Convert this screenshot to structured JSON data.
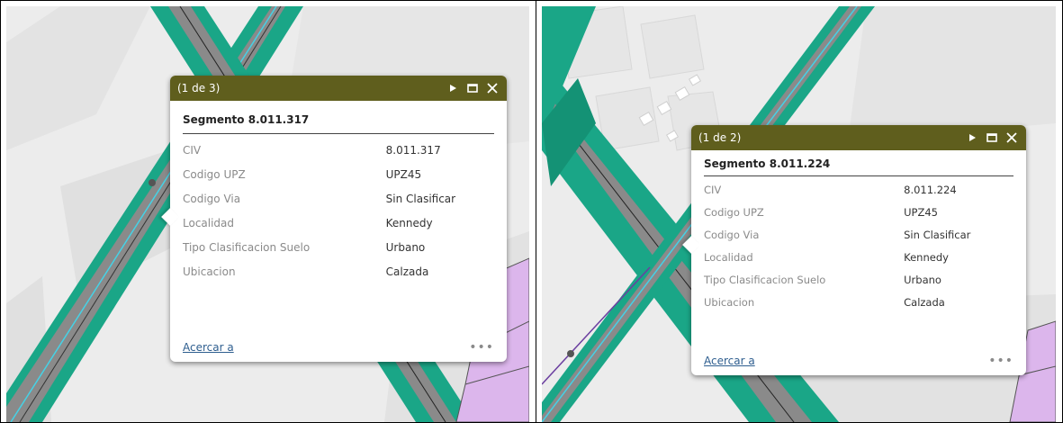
{
  "panels": [
    {
      "popup": {
        "count_label": "(1 de 3)",
        "title": "Segmento 8.011.317",
        "rows": [
          {
            "key": "CIV",
            "value": "8.011.317"
          },
          {
            "key": "Codigo UPZ",
            "value": "UPZ45"
          },
          {
            "key": "Codigo Via",
            "value": "Sin Clasificar"
          },
          {
            "key": "Localidad",
            "value": "Kennedy"
          },
          {
            "key": "Tipo Clasificacion Suelo",
            "value": "Urbano"
          },
          {
            "key": "Ubicacion",
            "value": "Calzada"
          }
        ],
        "zoom_link": "Acercar a",
        "more_label": "•••"
      }
    },
    {
      "popup": {
        "count_label": "(1 de 2)",
        "title": "Segmento 8.011.224",
        "rows": [
          {
            "key": "CIV",
            "value": "8.011.224"
          },
          {
            "key": "Codigo UPZ",
            "value": "UPZ45"
          },
          {
            "key": "Codigo Via",
            "value": "Sin Clasificar"
          },
          {
            "key": "Localidad",
            "value": "Kennedy"
          },
          {
            "key": "Tipo Clasificacion Suelo",
            "value": "Urbano"
          },
          {
            "key": "Ubicacion",
            "value": "Calzada"
          }
        ],
        "zoom_link": "Acercar a",
        "more_label": "•••"
      }
    }
  ],
  "icons": {
    "next": "play-triangle-icon",
    "maximize": "square-outline-icon",
    "close": "x-close-icon"
  },
  "colors": {
    "popup_header": "#5f5e1d",
    "road_green": "#1aa687",
    "road_gray": "#8a8a8a",
    "road_line_cyan": "#45d2e6",
    "parcel_pink": "#dcb6ec",
    "map_bg": "#ececec",
    "link_blue": "#2e5e8f"
  }
}
